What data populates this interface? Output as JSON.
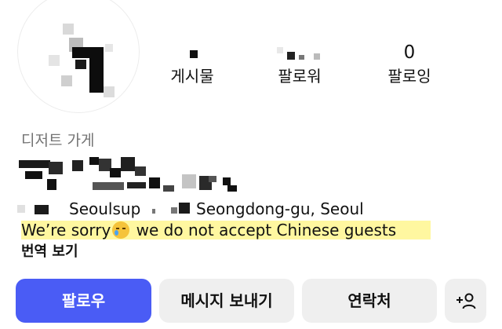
{
  "stats": {
    "posts": {
      "value": "",
      "label": "게시물"
    },
    "followers": {
      "value": "",
      "label": "팔로워"
    },
    "following": {
      "value": "0",
      "label": "팔로잉"
    }
  },
  "profile": {
    "category": "디저트 가게",
    "location": {
      "place": "Seoulsup",
      "area": "Seongdong-gu, Seoul"
    },
    "bio": {
      "before_emoji": "We’re sorry",
      "emoji": "face-with-tear-emoji",
      "after_emoji": " we do not accept Chinese guests"
    },
    "translate_label": "번역 보기"
  },
  "actions": {
    "follow_label": "팔로우",
    "message_label": "메시지 보내기",
    "contact_label": "연락처",
    "add_user_icon": "add-user-icon"
  },
  "colors": {
    "follow_button": "#4a5cf5",
    "secondary_button": "#efefef",
    "bio_highlight": "#fff7a0",
    "category_text": "#737373"
  }
}
